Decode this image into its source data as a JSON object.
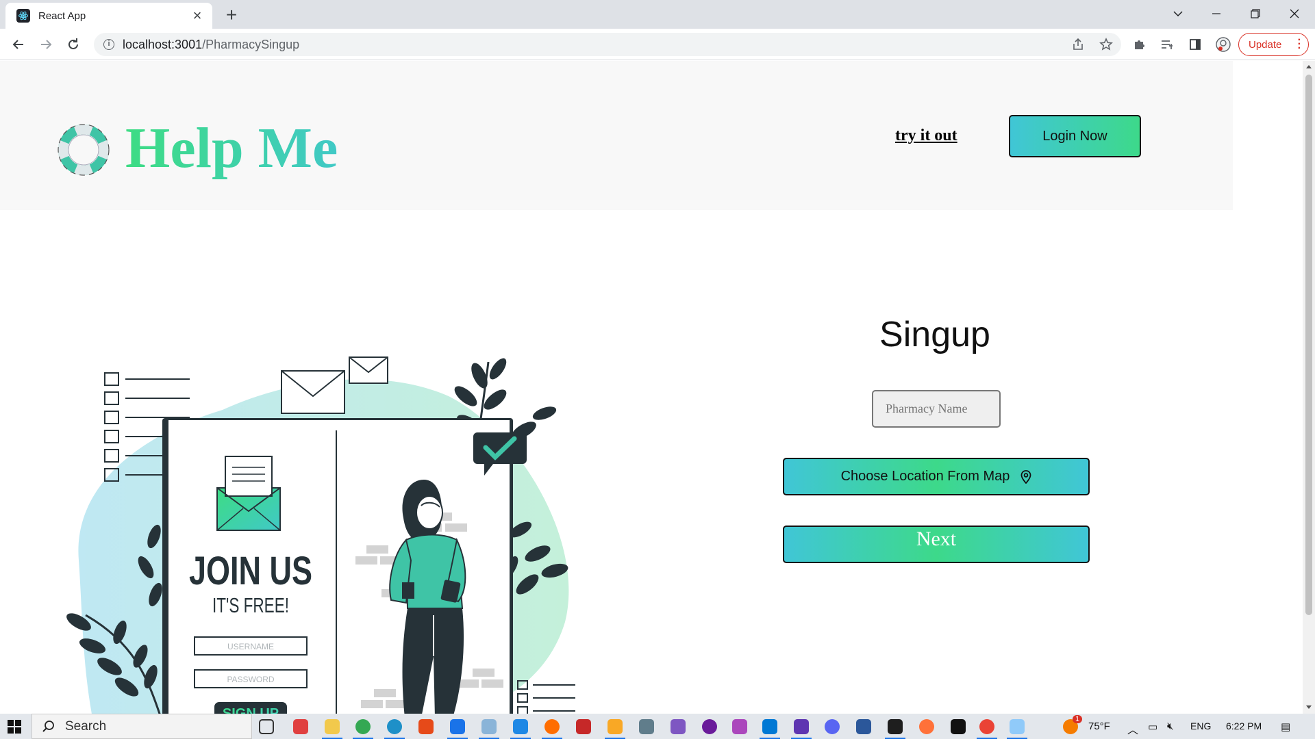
{
  "browser": {
    "tab_title": "React App",
    "url_host": "localhost:3001",
    "url_path": "/PharmacySingup",
    "update_label": "Update"
  },
  "header": {
    "brand": "Help Me",
    "try_link": "try it out",
    "login_label": "Login Now"
  },
  "form": {
    "title": "Singup",
    "pharmacy_name_placeholder": "Pharmacy Name",
    "map_button_label": "Choose Location From Map",
    "next_label": "Next"
  },
  "illustration": {
    "heading": "JOIN US",
    "subheading": "IT'S FREE!",
    "username_placeholder": "USERNAME",
    "password_placeholder": "PASSWORD",
    "signup_label": "SIGN UP"
  },
  "taskbar": {
    "search_label": "Search",
    "weather": "75°F",
    "language": "ENG",
    "time": "6:22 PM",
    "notification_badge": "1"
  },
  "colors": {
    "brand_green": "#3ddc84",
    "brand_teal": "#40c9c6",
    "dark": "#263238"
  }
}
